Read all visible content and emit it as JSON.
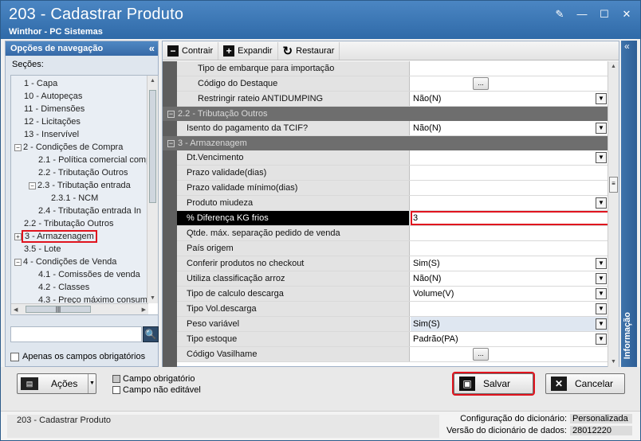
{
  "window": {
    "title": "203 - Cadastrar  Produto",
    "subtitle": "Winthor - PC Sistemas",
    "btn_edit": "✎",
    "btn_min": "—",
    "btn_max": "☐",
    "btn_close": "✕"
  },
  "nav": {
    "header": "Opções de navegação",
    "collapse": "«",
    "sections_label": "Seções:",
    "items": [
      {
        "label": "1 - Capa",
        "level": 1
      },
      {
        "label": "10 - Autopeças",
        "level": 1
      },
      {
        "label": "11 - Dimensões",
        "level": 1
      },
      {
        "label": "12 - Licitações",
        "level": 1
      },
      {
        "label": "13 - Inservível",
        "level": 1
      },
      {
        "label": "2 - Condições de Compra",
        "level": 1,
        "expander": "−"
      },
      {
        "label": "2.1 - Política comercial comp",
        "level": 2
      },
      {
        "label": "2.2 - Tributação Outros",
        "level": 2
      },
      {
        "label": "2.3 - Tributação entrada",
        "level": 2,
        "expander": "−"
      },
      {
        "label": "2.3.1 - NCM",
        "level": 3
      },
      {
        "label": "2.4 - Tributação entrada In",
        "level": 2
      },
      {
        "label": "2.2 - Tributação Outros",
        "level": 1
      },
      {
        "label": "3 - Armazenagem",
        "level": 1,
        "expander": "+",
        "highlight": true
      },
      {
        "label": "3.5 - Lote",
        "level": 1
      },
      {
        "label": "4 - Condições de Venda",
        "level": 1,
        "expander": "−"
      },
      {
        "label": "4.1 - Comissões de venda",
        "level": 2
      },
      {
        "label": "4.2 - Classes",
        "level": 2
      },
      {
        "label": "4.3 - Preço máximo consum",
        "level": 2
      }
    ],
    "search_icon": "magnifier-icon",
    "search_glyph": "🔍",
    "hscroll_grip": "|||",
    "only_required_label": "Apenas os campos obrigatórios"
  },
  "toolbar": {
    "contrair": "Contrair",
    "expandir": "Expandir",
    "restaurar": "Restaurar",
    "contrair_glyph": "−",
    "expandir_glyph": "+",
    "restaurar_glyph": "↻"
  },
  "grid": {
    "rows": [
      {
        "type": "row",
        "name": "Tipo de embarque para importação",
        "value": "",
        "sub": true
      },
      {
        "type": "row",
        "name": "Código do Destaque",
        "value": "",
        "sub": true,
        "ellipsis": "..."
      },
      {
        "type": "row",
        "name": "Restringir rateio ANTIDUMPING",
        "value": "Não(N)",
        "sub": true,
        "dropdown": true
      },
      {
        "type": "cat",
        "name": "2.2 - Tributação Outros"
      },
      {
        "type": "row",
        "name": "Isento do pagamento da TCIF?",
        "value": "Não(N)",
        "dropdown": true
      },
      {
        "type": "cat",
        "name": "3 - Armazenagem"
      },
      {
        "type": "row",
        "name": "Dt.Vencimento",
        "value": "",
        "dropdown": true
      },
      {
        "type": "row",
        "name": "Prazo validade(dias)",
        "value": ""
      },
      {
        "type": "row",
        "name": "Prazo validade mínimo(dias)",
        "value": ""
      },
      {
        "type": "row",
        "name": "Produto miudeza",
        "value": "",
        "dropdown": true
      },
      {
        "type": "row",
        "name": "% Diferença KG frios",
        "value": "3",
        "selected": true
      },
      {
        "type": "row",
        "name": "Qtde. máx. separação pedido de venda",
        "value": ""
      },
      {
        "type": "row",
        "name": "País origem",
        "value": ""
      },
      {
        "type": "row",
        "name": "Conferir produtos no checkout",
        "value": "Sim(S)",
        "dropdown": true
      },
      {
        "type": "row",
        "name": "Utiliza classificação arroz",
        "value": "Não(N)",
        "dropdown": true
      },
      {
        "type": "row",
        "name": "Tipo de calculo descarga",
        "value": "Volume(V)",
        "dropdown": true
      },
      {
        "type": "row",
        "name": "Tipo Vol.descarga",
        "value": "",
        "dropdown": true
      },
      {
        "type": "row",
        "name": "Peso variável",
        "value": "Sim(S)",
        "dropdown": true,
        "alt": true
      },
      {
        "type": "row",
        "name": "Tipo estoque",
        "value": "Padrão(PA)",
        "dropdown": true
      },
      {
        "type": "row",
        "name": "Código Vasilhame",
        "value": "",
        "ellipsis": "..."
      }
    ],
    "collapse_glyph": "−",
    "dropdown_glyph": "▼",
    "scroll_grip": "≡"
  },
  "info_panel": {
    "label": "Informação",
    "collapse": "«"
  },
  "bottom": {
    "acoes": "Ações",
    "acoes_glyph": "▤",
    "acoes_drop": "▼",
    "legend_required": "Campo obrigatório",
    "legend_readonly": "Campo não editável",
    "salvar": "Salvar",
    "salvar_glyph": "▣",
    "cancelar": "Cancelar",
    "cancelar_glyph": "✕"
  },
  "status": {
    "routine": "203 - Cadastrar  Produto",
    "config_label": "Configuração do dicionário:",
    "config_value": "Personalizada",
    "version_label": "Versão do dicionário de dados:",
    "version_value": "28012220"
  }
}
